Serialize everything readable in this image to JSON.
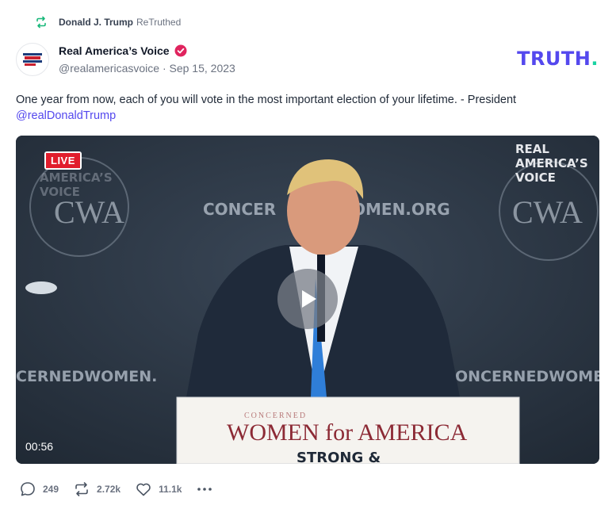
{
  "retruth": {
    "user": "Donald J. Trump",
    "suffix": "ReTruthed"
  },
  "author": {
    "name": "Real America’s Voice",
    "handle": "@realamericasvoice",
    "separator": "·",
    "date": "Sep 15, 2023",
    "verified": true
  },
  "brand": {
    "logo_main": "TRUTH",
    "logo_dot": ".",
    "color": "#5448ee",
    "dot_color": "#19d3a2"
  },
  "post": {
    "text": "One year from now, each of you will vote in the most important election of your lifetime. - President ",
    "mention": "@realDonaldTrump"
  },
  "video": {
    "live_label": "LIVE",
    "duration": "00:56",
    "watermark": [
      "REAL",
      "AMERICA’S",
      "VOICE"
    ],
    "backdrop_left": "CONCER",
    "backdrop_right": "OMEN.ORG",
    "backdrop_lower_left": "CERNEDWOMEN.",
    "backdrop_lower_right": "CONCERNEDWOME",
    "seal_text": "CWA",
    "podium_small": "CONCERNED",
    "podium_main": "WOMEN for AMERICA",
    "podium_sub": "STRONG &"
  },
  "actions": {
    "replies": "249",
    "retruths": "2.72k",
    "likes": "11.1k"
  },
  "icons": [
    "retruth-icon",
    "verified-icon",
    "play-icon",
    "reply-icon",
    "like-icon",
    "more-icon"
  ]
}
